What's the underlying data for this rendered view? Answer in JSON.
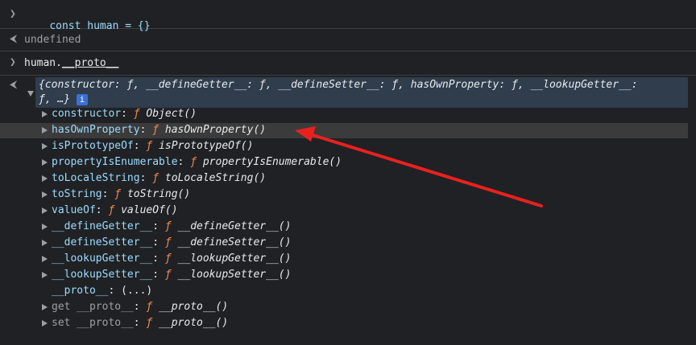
{
  "console": {
    "entries": [
      {
        "type": "input",
        "text": "const human = {}"
      },
      {
        "type": "output",
        "text": "undefined"
      },
      {
        "type": "input",
        "prefix": "human.",
        "suffix": "__proto__"
      }
    ],
    "object_preview": {
      "line1": "{constructor: ƒ, __defineGetter__: ƒ, __defineSetter__: ƒ, hasOwnProperty: ƒ, __lookupGetter__: ",
      "line2": "ƒ, …}",
      "info_badge": "i"
    },
    "properties": [
      {
        "name": "constructor",
        "sep": ": ",
        "fn_symbol": "ƒ",
        "fn_name": "Object()"
      },
      {
        "name": "hasOwnProperty",
        "sep": ": ",
        "fn_symbol": "ƒ",
        "fn_name": "hasOwnProperty()"
      },
      {
        "name": "isPrototypeOf",
        "sep": ": ",
        "fn_symbol": "ƒ",
        "fn_name": "isPrototypeOf()"
      },
      {
        "name": "propertyIsEnumerable",
        "sep": ": ",
        "fn_symbol": "ƒ",
        "fn_name": "propertyIsEnumerable()"
      },
      {
        "name": "toLocaleString",
        "sep": ": ",
        "fn_symbol": "ƒ",
        "fn_name": "toLocaleString()"
      },
      {
        "name": "toString",
        "sep": ": ",
        "fn_symbol": "ƒ",
        "fn_name": "toString()"
      },
      {
        "name": "valueOf",
        "sep": ": ",
        "fn_symbol": "ƒ",
        "fn_name": "valueOf()"
      },
      {
        "name": "__defineGetter__",
        "sep": ": ",
        "fn_symbol": "ƒ",
        "fn_name": "__defineGetter__()"
      },
      {
        "name": "__defineSetter__",
        "sep": ": ",
        "fn_symbol": "ƒ",
        "fn_name": "__defineSetter__()"
      },
      {
        "name": "__lookupGetter__",
        "sep": ": ",
        "fn_symbol": "ƒ",
        "fn_name": "__lookupGetter__()"
      },
      {
        "name": "__lookupSetter__",
        "sep": ": ",
        "fn_symbol": "ƒ",
        "fn_name": "__lookupSetter__()"
      },
      {
        "name": "__proto__",
        "sep": ": ",
        "value": "(...)"
      },
      {
        "name": "get __proto__",
        "sep": ": ",
        "fn_symbol": "ƒ",
        "fn_name": "__proto__()"
      },
      {
        "name": "set __proto__",
        "sep": ": ",
        "fn_symbol": "ƒ",
        "fn_name": "__proto__()"
      }
    ],
    "prompt_icons": {
      "input": "chevron-right-icon",
      "output": "arrow-left-icon"
    },
    "colors": {
      "background": "#202124",
      "annotation_arrow": "#e8211f",
      "fn_symbol": "#f28b54",
      "property": "#9cdcfe"
    }
  }
}
